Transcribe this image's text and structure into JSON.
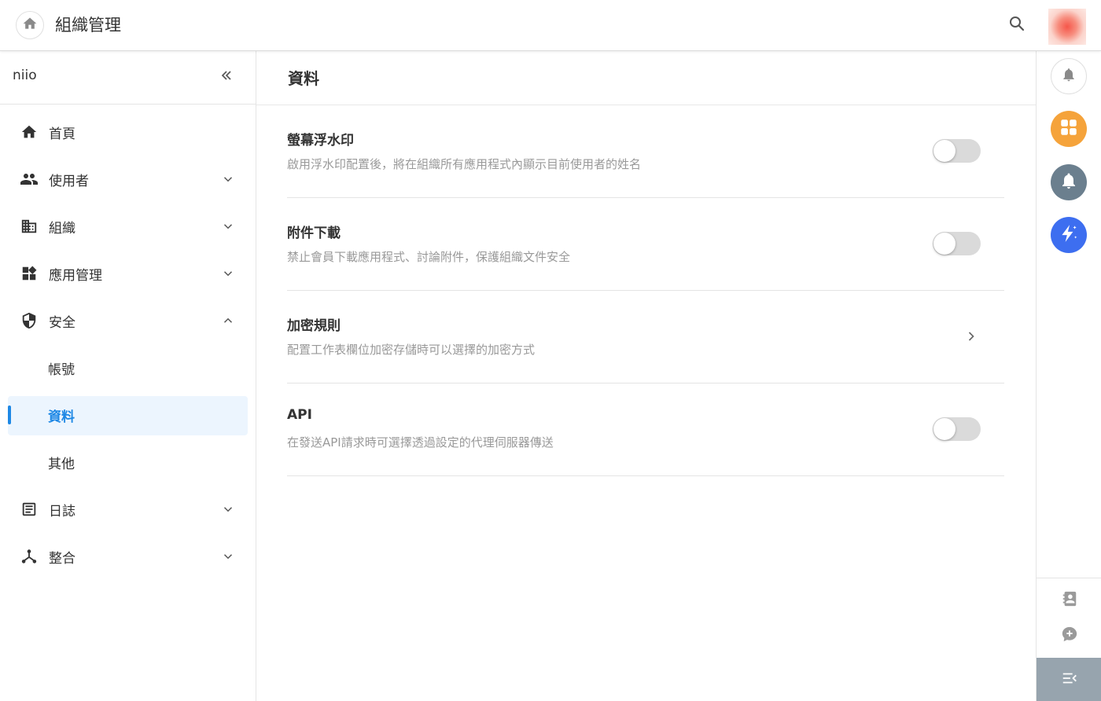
{
  "header": {
    "title": "組織管理",
    "home_icon": "home-icon",
    "search_icon": "search-icon"
  },
  "sidebar": {
    "org_name": "niio",
    "collapse_icon": "double-chevron-left-icon",
    "items": [
      {
        "label": "首頁",
        "icon": "home-icon",
        "expandable": false
      },
      {
        "label": "使用者",
        "icon": "people-icon",
        "expandable": true,
        "expanded": false
      },
      {
        "label": "組織",
        "icon": "building-icon",
        "expandable": true,
        "expanded": false
      },
      {
        "label": "應用管理",
        "icon": "widgets-icon",
        "expandable": true,
        "expanded": false
      },
      {
        "label": "安全",
        "icon": "shield-icon",
        "expandable": true,
        "expanded": true,
        "children": [
          {
            "label": "帳號",
            "active": false
          },
          {
            "label": "資料",
            "active": true
          },
          {
            "label": "其他",
            "active": false
          }
        ]
      },
      {
        "label": "日誌",
        "icon": "article-icon",
        "expandable": true,
        "expanded": false
      },
      {
        "label": "整合",
        "icon": "hub-icon",
        "expandable": true,
        "expanded": false
      }
    ]
  },
  "main": {
    "title": "資料",
    "settings": [
      {
        "title": "螢幕浮水印",
        "description": "啟用浮水印配置後，將在組織所有應用程式內顯示目前使用者的姓名",
        "control": "toggle",
        "enabled": false
      },
      {
        "title": "附件下載",
        "description": "禁止會員下載應用程式、討論附件，保護組織文件安全",
        "control": "toggle",
        "enabled": false
      },
      {
        "title": "加密規則",
        "description": "配置工作表欄位加密存儲時可以選擇的加密方式",
        "control": "chevron",
        "enabled": null
      },
      {
        "title": "API",
        "description": "在發送API請求時可選擇透過設定的代理伺服器傳送",
        "control": "toggle",
        "enabled": false
      }
    ]
  },
  "rail": {
    "notify_icon": "notification-bell-icon",
    "apps_icon": "apps-grid-icon",
    "bell_icon": "bell-icon",
    "spark_icon": "lightning-sparkle-icon",
    "contacts_icon": "contacts-icon",
    "chat_icon": "add-chat-icon",
    "menu_icon": "menu-collapse-icon"
  },
  "colors": {
    "accent": "#1e88e5",
    "active_bg": "#ecf5fe",
    "apps_orange": "#f5a33b",
    "bell_gray": "#6b7f8e",
    "spark_blue": "#3d6ef0",
    "rail_menu_bg": "#97a4ae"
  }
}
